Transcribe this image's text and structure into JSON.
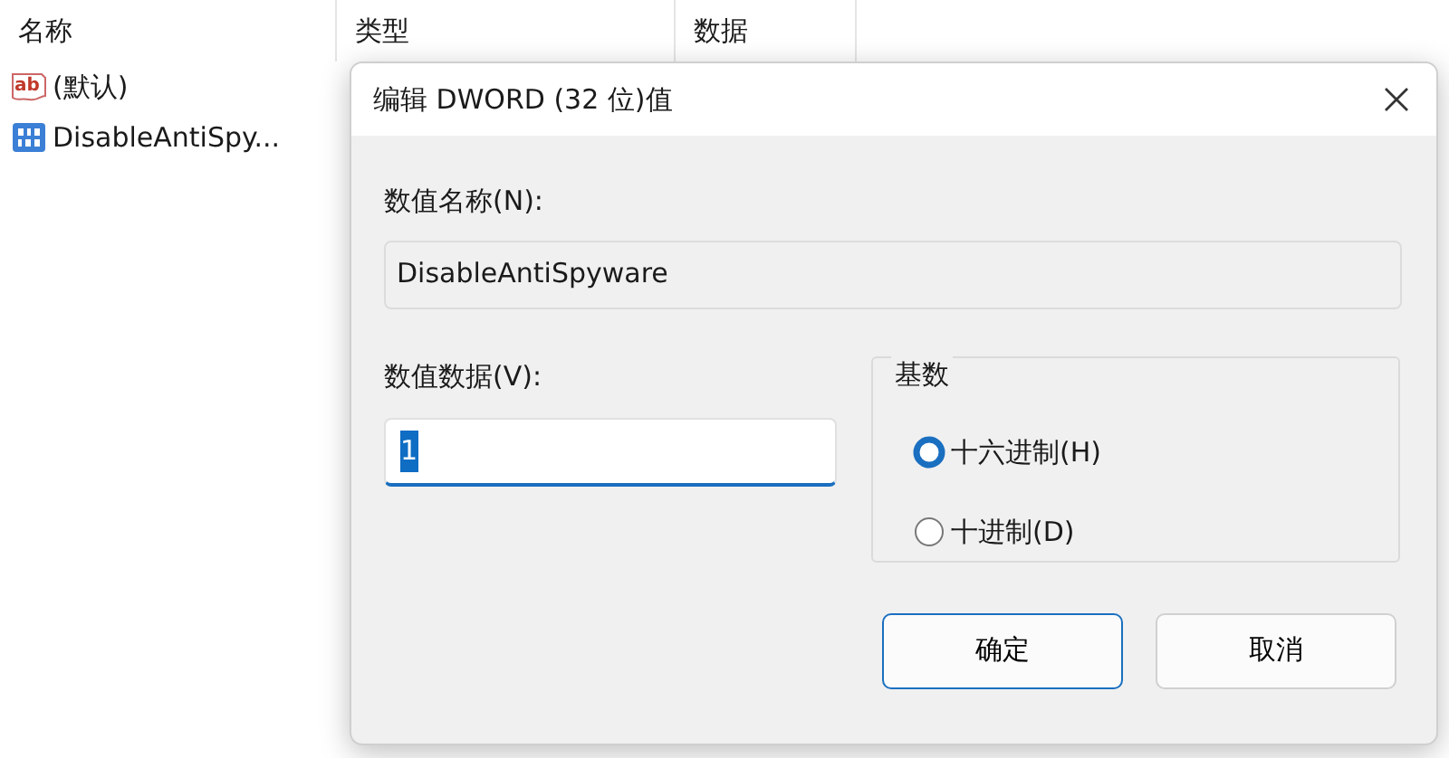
{
  "list": {
    "columns": [
      "名称",
      "类型",
      "数据"
    ],
    "rows": [
      {
        "kind": "string",
        "icon_text": "ab",
        "name": "(默认)"
      },
      {
        "kind": "dword",
        "name": "DisableAntiSpy..."
      }
    ]
  },
  "dialog": {
    "title": "编辑 DWORD (32 位)值",
    "name_label": "数值名称(N):",
    "name_value": "DisableAntiSpyware",
    "data_label": "数值数据(V):",
    "data_value": "1",
    "data_text_selected": true,
    "base": {
      "title": "基数",
      "options": [
        {
          "label": "十六进制(H)",
          "selected": true
        },
        {
          "label": "十进制(D)",
          "selected": false
        }
      ]
    },
    "buttons": [
      {
        "label": "确定",
        "default": true
      },
      {
        "label": "取消",
        "default": false
      }
    ]
  }
}
